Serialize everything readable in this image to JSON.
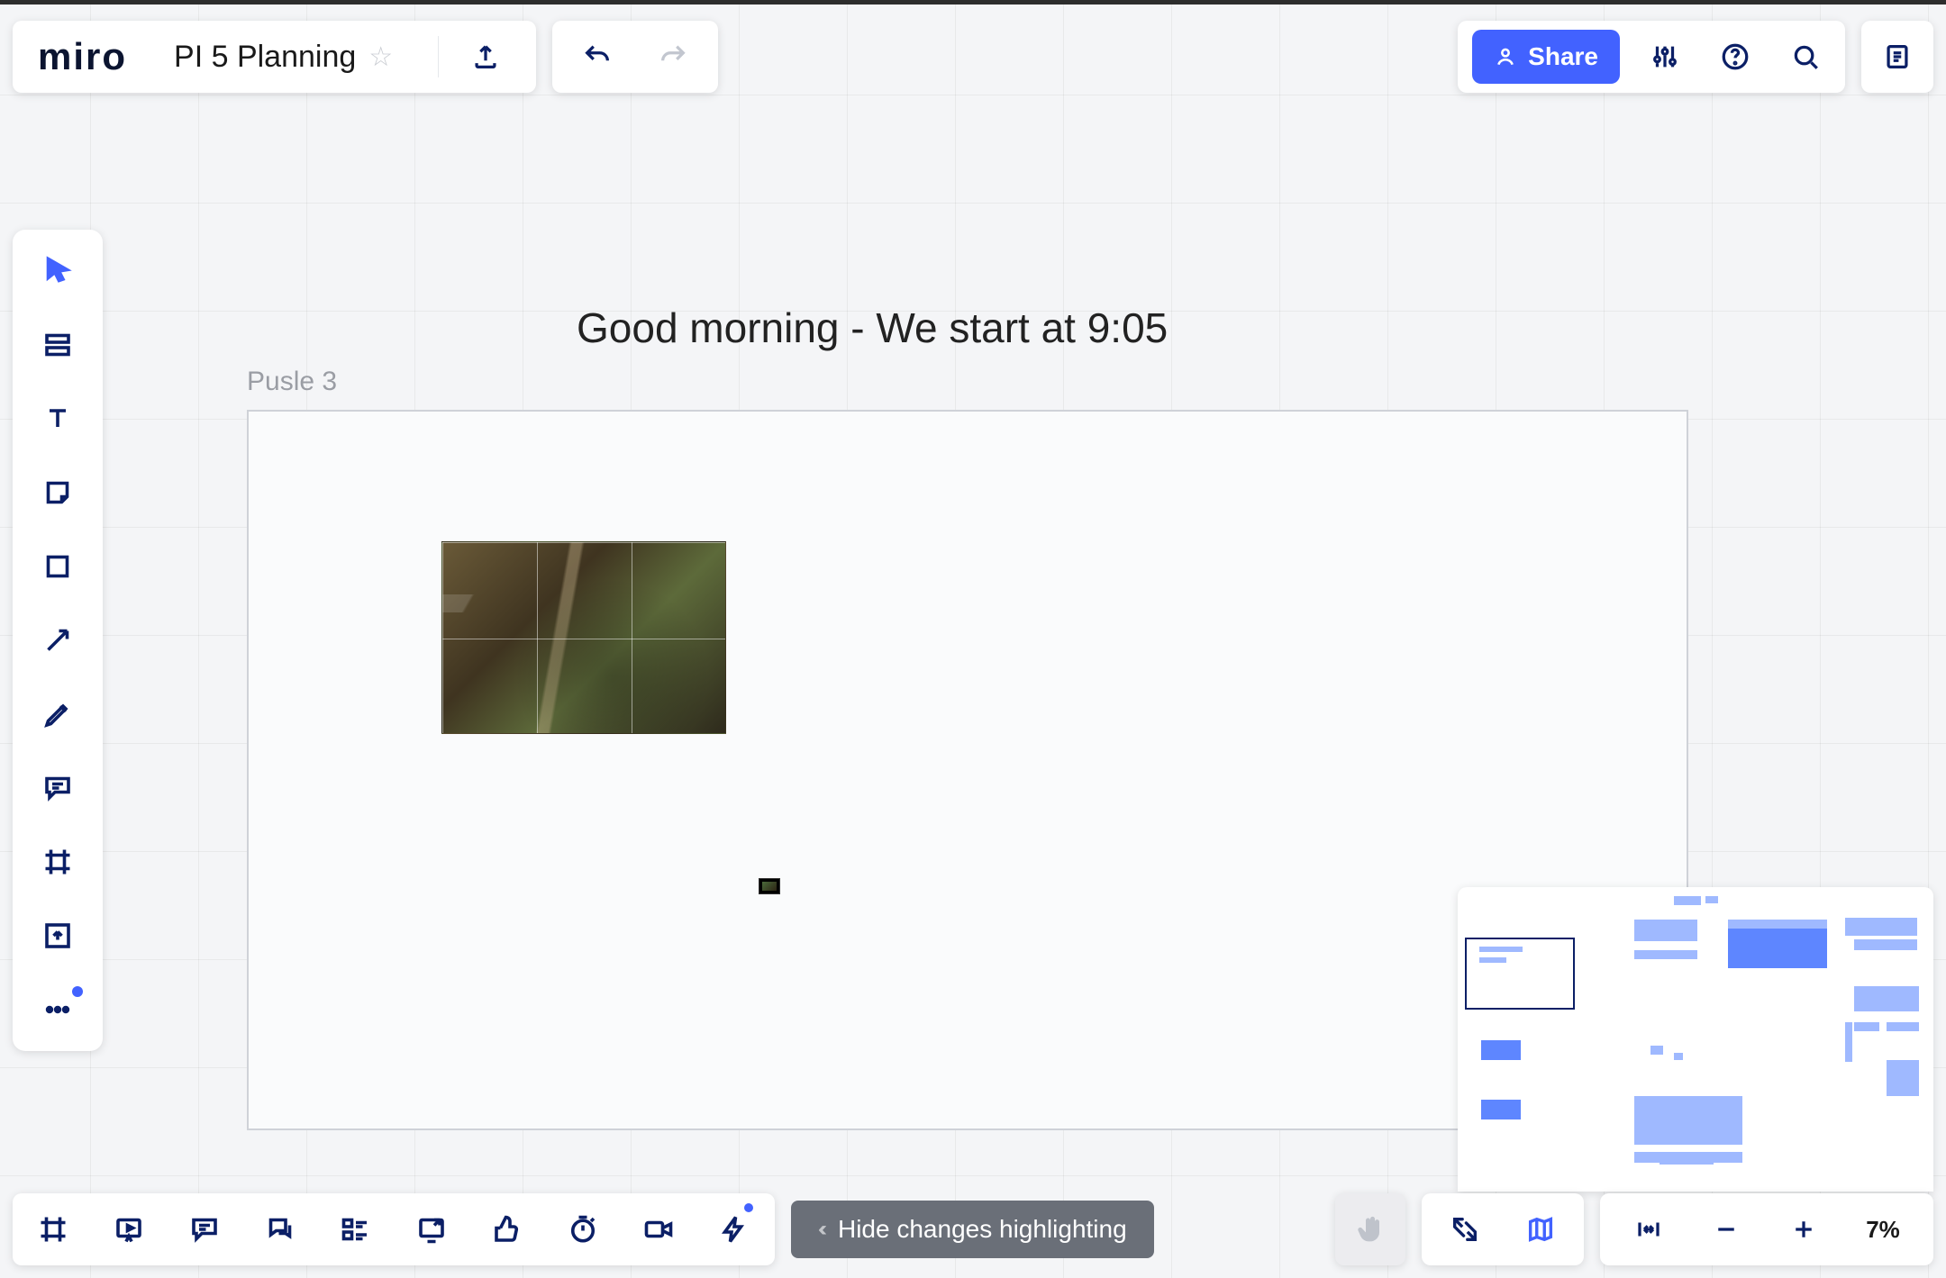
{
  "app": {
    "logo": "miro"
  },
  "board": {
    "title": "PI 5 Planning",
    "starred": false
  },
  "header": {
    "export_label": "Export",
    "undo_label": "Undo",
    "redo_label": "Redo",
    "share_label": "Share",
    "settings_label": "Settings",
    "help_label": "Help",
    "search_label": "Search",
    "notes_label": "Notes"
  },
  "left_toolbar": {
    "tools": [
      "select",
      "templates",
      "text",
      "sticky-note",
      "shape",
      "connection-line",
      "pen",
      "comment",
      "frame",
      "upload",
      "more"
    ]
  },
  "canvas": {
    "headline": "Good morning - We start at 9:05",
    "frame_label": "Pusle 3"
  },
  "bottom_toolbar": {
    "tools": [
      "frames-list",
      "presentation",
      "comments-panel",
      "chat",
      "cards",
      "screen-share",
      "reactions",
      "timer",
      "video",
      "activities"
    ],
    "hide_changes_label": "Hide changes highlighting"
  },
  "navigation": {
    "fullscreen_label": "Fit",
    "map_label": "Map",
    "fit_width_label": "Fit width",
    "zoom_out_label": "Zoom out",
    "zoom_in_label": "Zoom in",
    "zoom_value": "7%"
  },
  "colors": {
    "accent": "#4262ff",
    "ink": "#0b1f66"
  }
}
